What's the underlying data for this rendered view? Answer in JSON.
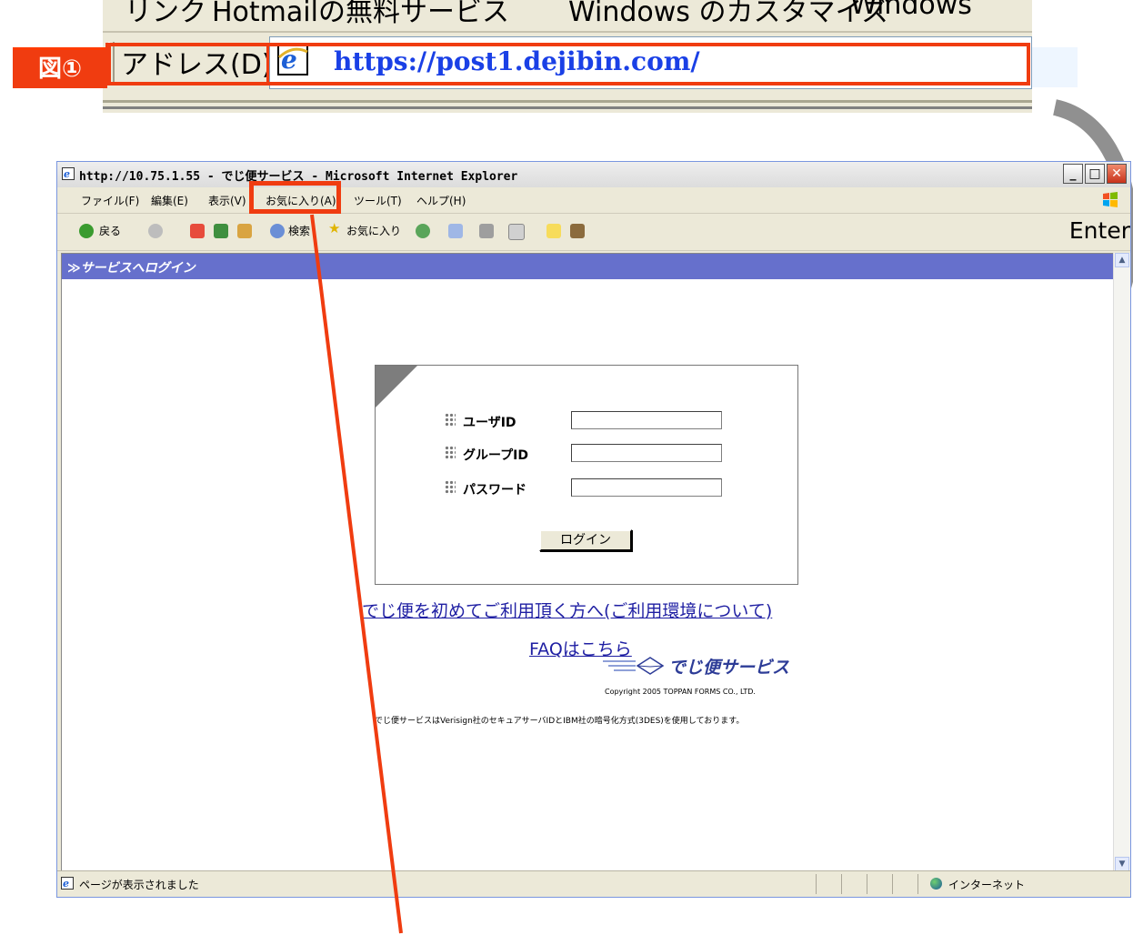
{
  "zoom_strip": {
    "links_row_fragments": [
      "リンク",
      "Hotmailの無料サービス",
      "Windows のカスタマイズ",
      "Windows"
    ],
    "address_label": "アドレス(D)",
    "address_url": "https://post1.dejibin.com/"
  },
  "annotations": {
    "figure_label": "図①",
    "enter_label": "Enter",
    "accent_color": "#f03c10"
  },
  "browser": {
    "title": "http://10.75.1.55 - でじ便サービス - Microsoft Internet Explorer",
    "menu": [
      "ファイル(F)",
      "編集(E)",
      "表示(V)",
      "お気に入り(A)",
      "ツール(T)",
      "ヘルプ(H)"
    ],
    "toolbar": {
      "back": "戻る",
      "search": "検索",
      "favorites": "お気に入り"
    },
    "status_text": "ページが表示されました",
    "zone_text": "インターネット"
  },
  "page": {
    "header_title": "≫サービスへログイン",
    "fields": [
      {
        "label": "ユーザID",
        "value": ""
      },
      {
        "label": "グループID",
        "value": ""
      },
      {
        "label": "パスワード",
        "value": ""
      }
    ],
    "login_button": "ログイン",
    "link_first_time": "でじ便を初めてご利用頂く方へ(ご利用環境について)",
    "link_faq": "FAQはこちら",
    "brand_name": "でじ便サービス",
    "copyright": "Copyright 2005 TOPPAN FORMS CO., LTD.",
    "disclaimer": "でじ便サービスはVerisign社のセキュアサーバIDとIBM社の暗号化方式(3DES)を使用しております。"
  }
}
